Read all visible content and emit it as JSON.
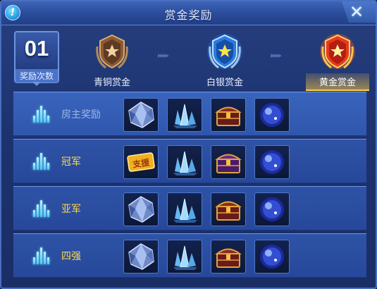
{
  "header": {
    "title": "赏金奖励",
    "info_icon": "exclamation-icon",
    "close_icon": "close-x-icon"
  },
  "reward_count": {
    "number": "01",
    "label": "奖励次数"
  },
  "tiers": [
    {
      "label": "青铜赏金",
      "medal": "bronze-star-medal-icon",
      "active": false
    },
    {
      "label": "白银赏金",
      "medal": "silver-star-medal-icon",
      "active": false
    },
    {
      "label": "黄金赏金",
      "medal": "gold-star-medal-icon",
      "active": true
    }
  ],
  "rows": [
    {
      "title": "房主奖励",
      "items": [
        "gem-icon",
        "crystal-cluster-icon",
        "treasure-chest-icon",
        "blue-orb-icon"
      ]
    },
    {
      "title": "冠军",
      "items": [
        "voucher-ticket-icon",
        "crystal-cluster-icon",
        "treasure-chest-purple-icon",
        "blue-orb-icon"
      ]
    },
    {
      "title": "亚军",
      "items": [
        "gem-icon",
        "crystal-cluster-icon",
        "treasure-chest-icon",
        "blue-orb-icon"
      ]
    },
    {
      "title": "四强",
      "items": [
        "gem-icon",
        "crystal-cluster-icon",
        "treasure-chest-icon",
        "blue-orb-icon"
      ]
    }
  ],
  "voucher_text": "支援"
}
